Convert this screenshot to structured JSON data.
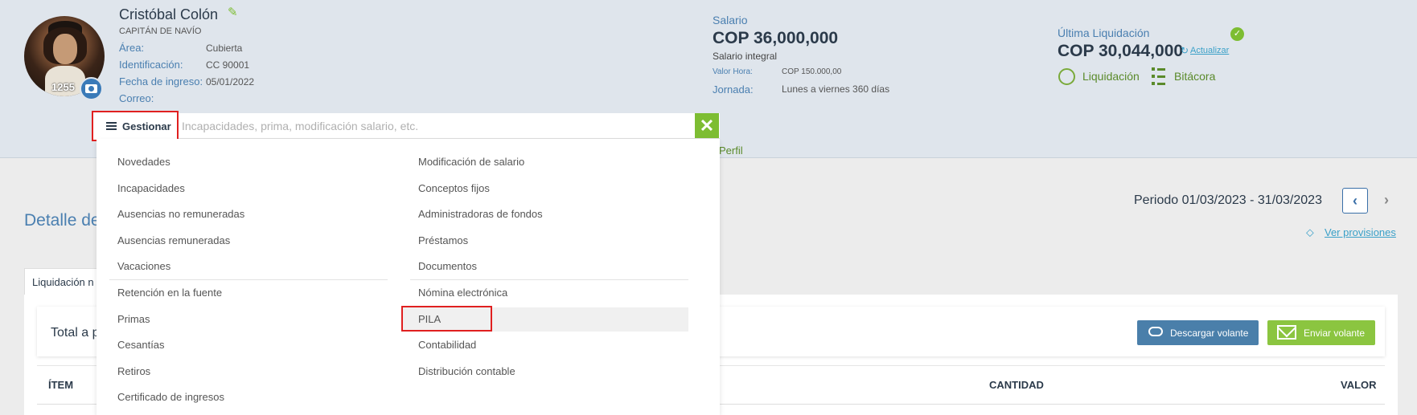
{
  "employee": {
    "name": "Cristóbal Colón",
    "role": "CAPITÁN DE NAVÍO",
    "avatar_number": "1255",
    "fields": [
      {
        "label": "Área:",
        "value": "Cubierta"
      },
      {
        "label": "Identificación:",
        "value": "CC 90001"
      },
      {
        "label": "Fecha de ingreso:",
        "value": "05/01/2022"
      },
      {
        "label": "Correo:",
        "value": ""
      }
    ]
  },
  "salary": {
    "label": "Salario",
    "value": "COP 36,000,000",
    "subtitle": "Salario integral",
    "hour_label": "Valor Hora:",
    "hour_value": "COP 150.000,00",
    "jornada_label": "Jornada:",
    "jornada_value": "Lunes a viernes 360 días"
  },
  "last_liquidation": {
    "label": "Última Liquidación",
    "value": "COP 30,044,000",
    "update_link": "Actualizar",
    "liquidacion_link": "Liquidación",
    "bitacora_link": "Bitácora"
  },
  "perfil_tab": "Perfil",
  "search": {
    "button_label": "Gestionar",
    "placeholder": "Incapacidades, prima, modificación salario, etc.",
    "close_label": "✕"
  },
  "menu": {
    "left": [
      "Novedades",
      "Incapacidades",
      "Ausencias no remuneradas",
      "Ausencias remuneradas",
      "Vacaciones",
      "Retención en la fuente",
      "Primas",
      "Cesantías",
      "Retiros",
      "Certificado de ingresos"
    ],
    "right": [
      "Modificación de salario",
      "Conceptos fijos",
      "Administradoras de fondos",
      "Préstamos",
      "Documentos",
      "Nómina electrónica",
      "PILA",
      "Contabilidad",
      "Distribución contable"
    ]
  },
  "main": {
    "title_fragment": "Detalle de",
    "period": "Periodo 01/03/2023 - 31/03/2023",
    "ver_provisiones": "Ver provisiones",
    "tab_fragment": "Liquidación n",
    "total_fragment": "Total a p",
    "download_button": "Descargar volante",
    "send_button": "Enviar volante",
    "columns": [
      "ÍTEM",
      "CANTIDAD",
      "VALOR"
    ]
  },
  "colors": {
    "accent_green": "#7dbd32",
    "accent_blue": "#4a7fb0",
    "highlight_red": "#e02020"
  }
}
